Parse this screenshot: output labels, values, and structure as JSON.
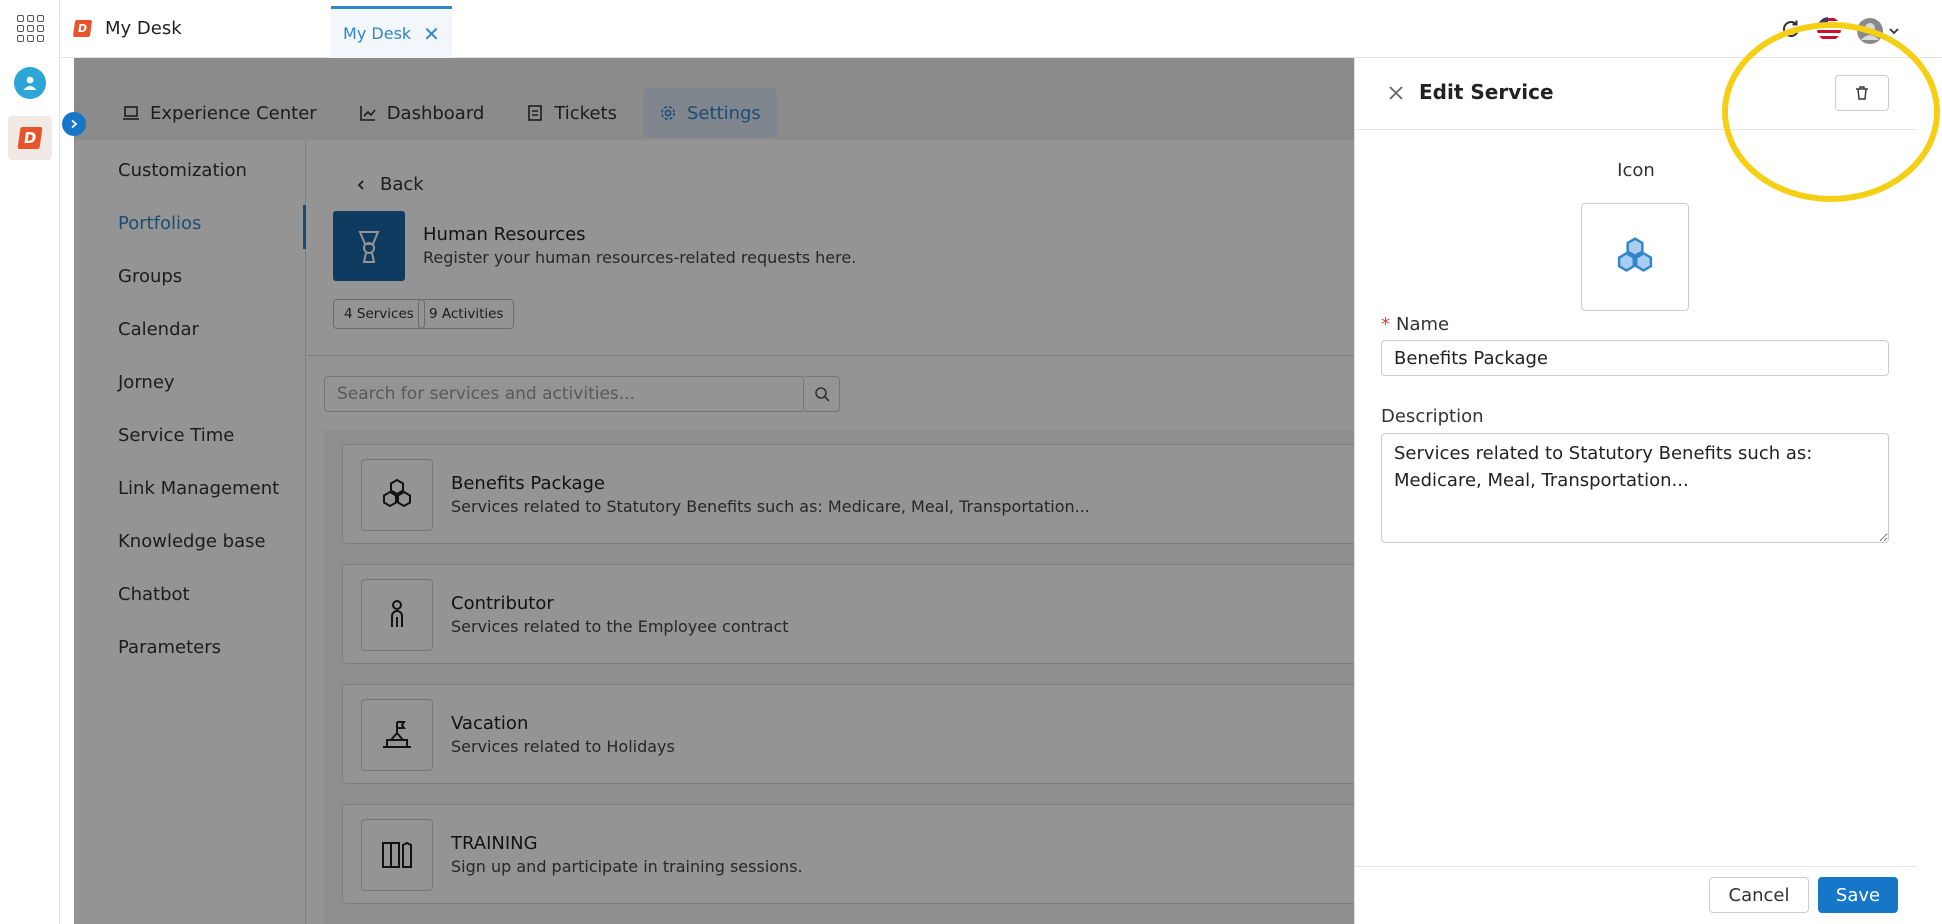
{
  "app": {
    "title": "My Desk",
    "logo_letter": "D"
  },
  "tabs": [
    {
      "label": "My Desk"
    }
  ],
  "nav": {
    "tabs": [
      {
        "label": "Experience Center",
        "icon": "laptop-icon"
      },
      {
        "label": "Dashboard",
        "icon": "chart-line-icon"
      },
      {
        "label": "Tickets",
        "icon": "ticket-icon"
      },
      {
        "label": "Settings",
        "icon": "gear-icon"
      }
    ]
  },
  "settings_menu": {
    "items": [
      {
        "label": "Customization"
      },
      {
        "label": "Portfolios"
      },
      {
        "label": "Groups"
      },
      {
        "label": "Calendar"
      },
      {
        "label": "Jorney"
      },
      {
        "label": "Service Time"
      },
      {
        "label": "Link Management"
      },
      {
        "label": "Knowledge base"
      },
      {
        "label": "Chatbot"
      },
      {
        "label": "Parameters"
      }
    ],
    "active": "Portfolios"
  },
  "portfolio": {
    "back_label": "Back",
    "title": "Human Resources",
    "description": "Register your human resources-related requests here.",
    "services_chip": "4 Services",
    "activities_chip": "9 Activities",
    "search_placeholder": "Search for services and activities...",
    "services": [
      {
        "name": "Benefits Package",
        "description": "Services related to Statutory Benefits such as: Medicare, Meal, Transportation...",
        "icon": "hexagons-icon"
      },
      {
        "name": "Contributor",
        "description": "Services related to the Employee contract",
        "icon": "person-icon"
      },
      {
        "name": "Vacation",
        "description": "Services related to Holidays",
        "icon": "beach-flag-icon"
      },
      {
        "name": "TRAINING",
        "description": "Sign up and participate in training sessions.",
        "icon": "books-icon"
      }
    ]
  },
  "edit_panel": {
    "title": "Edit Service",
    "icon_label": "Icon",
    "name_label": "Name",
    "name_value": "Benefits Package",
    "description_label": "Description",
    "description_value": "Services related to Statutory Benefits such as: Medicare, Meal, Transportation...",
    "cancel_label": "Cancel",
    "save_label": "Save"
  },
  "colors": {
    "accent": "#1677c8",
    "brand": "#e8542a",
    "highlight": "#f5cf13"
  }
}
